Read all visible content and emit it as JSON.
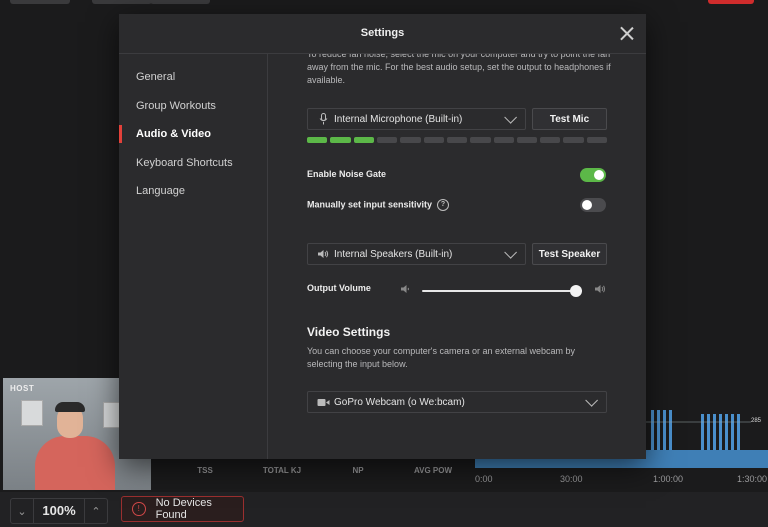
{
  "background": {
    "host_label": "HOST",
    "stats": [
      "TSS",
      "TOTAL KJ",
      "NP",
      "AVG POW"
    ],
    "chart_marker": "285",
    "timeline": [
      "0:00",
      "30:00",
      "1:00:00",
      "1:30:00"
    ],
    "zoom": {
      "value": "100%"
    },
    "devices_status": "No Devices Found"
  },
  "modal": {
    "title": "Settings",
    "nav": [
      {
        "label": "General"
      },
      {
        "label": "Group Workouts"
      },
      {
        "label": "Audio & Video",
        "active": true
      },
      {
        "label": "Keyboard Shortcuts"
      },
      {
        "label": "Language"
      }
    ],
    "audio": {
      "intro": "To reduce fan noise, select the mic on your computer and try to point the fan away from the mic. For the best audio setup, set the output to headphones if available.",
      "mic_select": "Internal Microphone (Built-in)",
      "test_mic_label": "Test Mic",
      "mic_level": {
        "active_segments": 3,
        "total_segments": 13
      },
      "noise_gate_label": "Enable Noise Gate",
      "noise_gate_on": true,
      "sensitivity_label": "Manually set input sensitivity",
      "sensitivity_on": false,
      "speaker_select": "Internal Speakers (Built-in)",
      "test_speaker_label": "Test Speaker",
      "output_volume_label": "Output Volume",
      "output_volume_fraction": 1.0
    },
    "video": {
      "title": "Video Settings",
      "description": "You can choose your computer's camera or an external webcam by selecting the input below.",
      "camera_select": "GoPro Webcam (o We:bcam)"
    }
  },
  "colors": {
    "accent_green": "#5cb848",
    "active_indicator": "#e3413a",
    "modal_bg": "#2b2b2d"
  }
}
